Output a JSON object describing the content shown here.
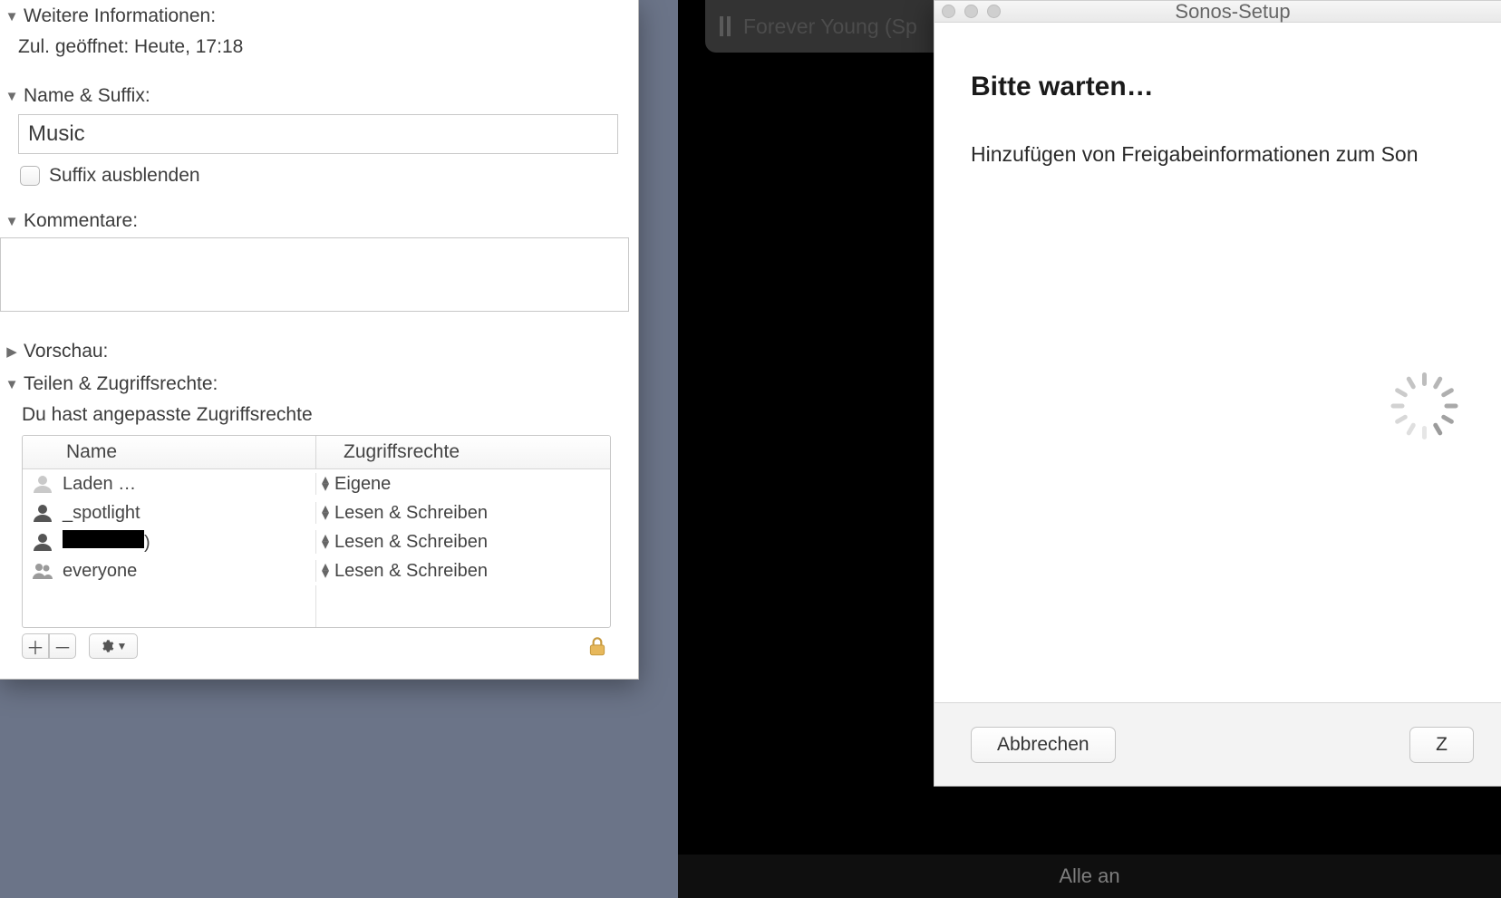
{
  "info": {
    "sections": {
      "more": {
        "label": "Weitere Informationen:",
        "open": true
      },
      "name": {
        "label": "Name & Suffix:",
        "open": true
      },
      "comments": {
        "label": "Kommentare:",
        "open": true
      },
      "preview": {
        "label": "Vorschau:",
        "open": false
      },
      "sharing": {
        "label": "Teilen & Zugriffsrechte:",
        "open": true
      }
    },
    "last_opened_label": "Zul. geöffnet:",
    "last_opened_value": "Heute, 17:18",
    "name_value": "Music",
    "hide_suffix_label": "Suffix ausblenden",
    "hide_suffix_checked": false,
    "comment_value": "",
    "permissions": {
      "message": "Du hast angepasste Zugriffsrechte",
      "col_name": "Name",
      "col_priv": "Zugriffsrechte",
      "rows": [
        {
          "icon": "user-gray",
          "name": "Laden …",
          "priv": "Eigene"
        },
        {
          "icon": "user",
          "name": "_spotlight",
          "priv": "Lesen & Schreiben"
        },
        {
          "icon": "user",
          "name": "████████",
          "priv": "Lesen & Schreiben",
          "redacted": true,
          "suffix": ")"
        },
        {
          "icon": "group",
          "name": "everyone",
          "priv": "Lesen & Schreiben"
        }
      ]
    }
  },
  "media": {
    "track": "Forever Young (Sp"
  },
  "dark_footer": "Alle an",
  "sonos": {
    "window_title": "Sonos-Setup",
    "heading": "Bitte warten…",
    "message": "Hinzufügen von Freigabeinformationen zum Son",
    "cancel": "Abbrechen",
    "next": "Z"
  }
}
